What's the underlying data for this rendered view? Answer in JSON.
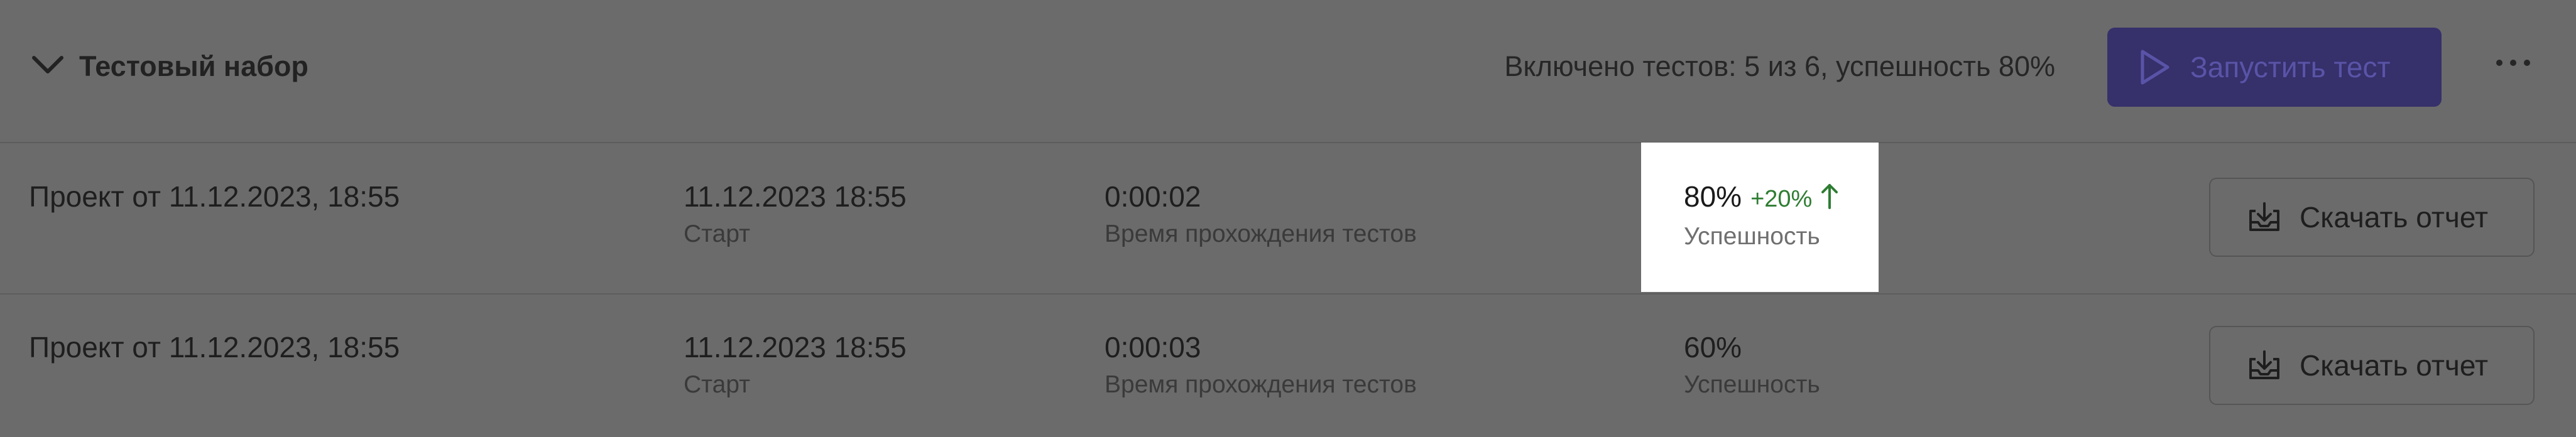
{
  "suite": {
    "title": "Тестовый набор",
    "summary": "Включено тестов: 5 из 6, успешность 80%",
    "run_label": "Запустить тест"
  },
  "rows": [
    {
      "project": "Проект от 11.12.2023, 18:55",
      "start_value": "11.12.2023 18:55",
      "start_label": "Старт",
      "duration_value": "0:00:02",
      "duration_label": "Время прохождения тестов",
      "success_value": "80%",
      "success_delta": "+20%",
      "success_label": "Успешность",
      "download_label": "Скачать отчет"
    },
    {
      "project": "Проект от 11.12.2023, 18:55",
      "start_value": "11.12.2023 18:55",
      "start_label": "Старт",
      "duration_value": "0:00:03",
      "duration_label": "Время прохождения тестов",
      "success_value": "60%",
      "success_label": "Успешность",
      "download_label": "Скачать отчет"
    }
  ],
  "colors": {
    "overlay": "#6b6b6b",
    "accent": "#36306b",
    "positive": "#2e7d32",
    "highlight": "#ffffff"
  },
  "icons": {
    "collapse": "chevron-down-icon",
    "run": "play-icon",
    "more": "more-horizontal-icon",
    "download": "download-tray-icon",
    "trend": "arrow-up-icon"
  }
}
